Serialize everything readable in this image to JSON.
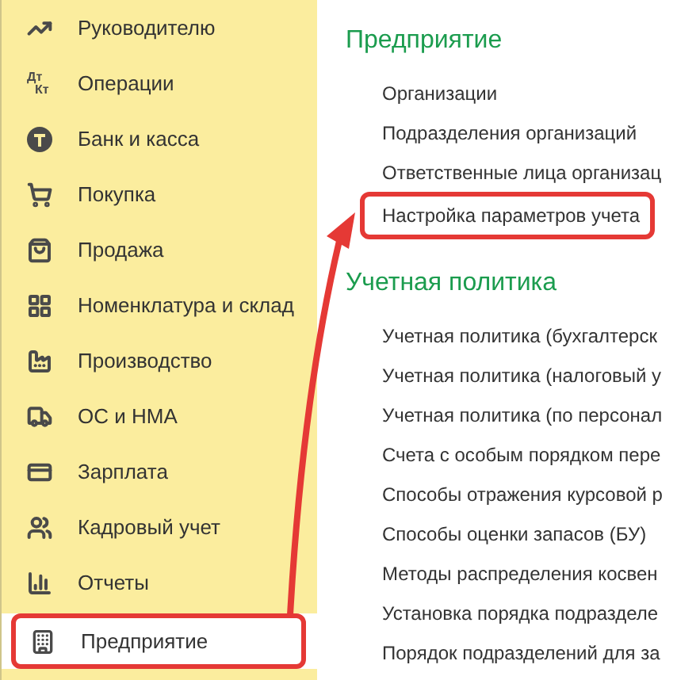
{
  "sidebar": {
    "items": [
      {
        "label": "Руководителю",
        "selected": false
      },
      {
        "label": "Операции",
        "icon_text": [
          "Дт",
          "Кт"
        ],
        "selected": false
      },
      {
        "label": "Банк и касса",
        "selected": false
      },
      {
        "label": "Покупка",
        "selected": false
      },
      {
        "label": "Продажа",
        "selected": false
      },
      {
        "label": "Номенклатура и склад",
        "selected": false
      },
      {
        "label": "Производство",
        "selected": false
      },
      {
        "label": "ОС и НМА",
        "selected": false
      },
      {
        "label": "Зарплата",
        "selected": false
      },
      {
        "label": "Кадровый учет",
        "selected": false
      },
      {
        "label": "Отчеты",
        "selected": false
      },
      {
        "label": "Предприятие",
        "selected": true
      }
    ]
  },
  "sections": [
    {
      "title": "Предприятие",
      "links": [
        {
          "label": "Организации",
          "highlighted": false
        },
        {
          "label": "Подразделения организаций",
          "highlighted": false
        },
        {
          "label": "Ответственные лица организац",
          "highlighted": false
        },
        {
          "label": "Настройка параметров учета",
          "highlighted": true
        }
      ]
    },
    {
      "title": "Учетная политика",
      "links": [
        {
          "label": "Учетная политика (бухгалтерск",
          "highlighted": false
        },
        {
          "label": "Учетная политика (налоговый у",
          "highlighted": false
        },
        {
          "label": "Учетная политика (по персонал",
          "highlighted": false
        },
        {
          "label": "Счета с особым порядком пере",
          "highlighted": false
        },
        {
          "label": "Способы отражения курсовой р",
          "highlighted": false
        },
        {
          "label": "Способы оценки запасов (БУ)",
          "highlighted": false
        },
        {
          "label": "Методы распределения косвен",
          "highlighted": false
        },
        {
          "label": "Установка порядка подразделе",
          "highlighted": false
        },
        {
          "label": "Порядок подразделений для за",
          "highlighted": false
        }
      ]
    }
  ]
}
